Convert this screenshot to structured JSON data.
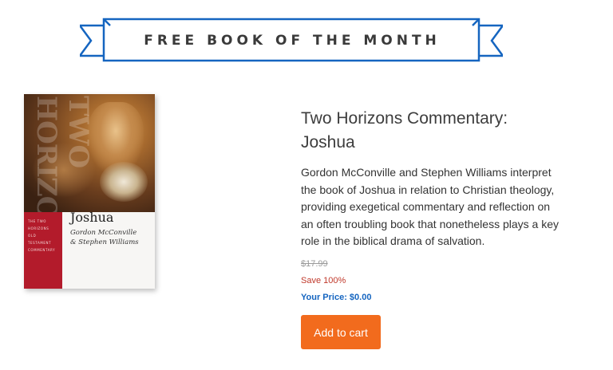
{
  "banner": {
    "title": "FREE BOOK OF THE MONTH",
    "color": "#1565c0"
  },
  "cover": {
    "vertical_text": "TWO HORIZONS",
    "series_lines": [
      "THE TWO HORIZONS",
      "OLD TESTAMENT",
      "COMMENTARY"
    ],
    "book_title": "Joshua",
    "authors_line1": "Gordon McConville",
    "authors_line2": "& Stephen Williams",
    "accent_color": "#b31b2b"
  },
  "book": {
    "title_line1": "Two Horizons Commentary:",
    "title_line2": "Joshua",
    "description": "Gordon McConville and Stephen Williams interpret the book of Joshua in relation to Christian theology, providing exegetical commentary and reflection on an often troubling book that nonetheless plays a key role in the biblical drama of salvation."
  },
  "pricing": {
    "old_price": "$17.99",
    "save_text": "Save 100%",
    "your_price": "Your Price: $0.00",
    "save_color": "#c0392b",
    "price_color": "#1565c0"
  },
  "cart": {
    "label": "Add to cart",
    "color": "#f26b1d"
  }
}
